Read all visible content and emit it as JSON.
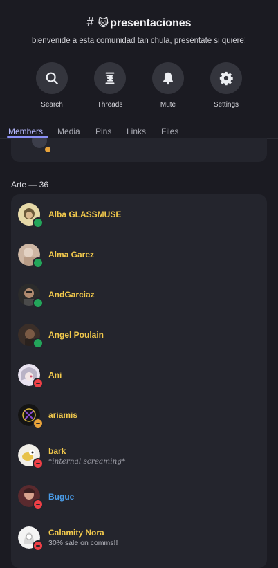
{
  "channel": {
    "hash": "#",
    "emoji": "😺",
    "name": "presentaciones",
    "description": "bienvenide a esta comunidad tan chula, preséntate si quiere!"
  },
  "actions": [
    {
      "label": "Search",
      "icon": "search-icon"
    },
    {
      "label": "Threads",
      "icon": "threads-icon"
    },
    {
      "label": "Mute",
      "icon": "bell-icon"
    },
    {
      "label": "Settings",
      "icon": "gear-icon"
    }
  ],
  "tabs": [
    {
      "label": "Members",
      "active": true
    },
    {
      "label": "Media",
      "active": false
    },
    {
      "label": "Pins",
      "active": false
    },
    {
      "label": "Links",
      "active": false
    },
    {
      "label": "Files",
      "active": false
    }
  ],
  "section": {
    "label": "Arte — 36"
  },
  "members": [
    {
      "name": "Alba GLASSMUSE",
      "status": "online",
      "subtitle": ""
    },
    {
      "name": "Alma Garez",
      "status": "online",
      "subtitle": ""
    },
    {
      "name": "AndGarciaz",
      "status": "online",
      "subtitle": ""
    },
    {
      "name": "Angel Poulain",
      "status": "online",
      "subtitle": ""
    },
    {
      "name": "Ani",
      "status": "dnd",
      "subtitle": ""
    },
    {
      "name": "ariamis",
      "status": "idle",
      "subtitle": ""
    },
    {
      "name": "bark",
      "status": "dnd",
      "subtitle": "*internal screaming*"
    },
    {
      "name": "Bugue",
      "status": "dnd",
      "subtitle": ""
    },
    {
      "name": "Calamity Nora",
      "status": "dnd",
      "subtitle": "30% sale on comms!!"
    }
  ],
  "colors": {
    "background": "#1b1b22",
    "card": "#24252d",
    "accent_tab": "#b7b9ff",
    "name_gold": "#f2c94c",
    "name_blue": "#4a9ce8",
    "online": "#23a55a",
    "dnd": "#ef3f46",
    "idle": "#e8a33a"
  }
}
